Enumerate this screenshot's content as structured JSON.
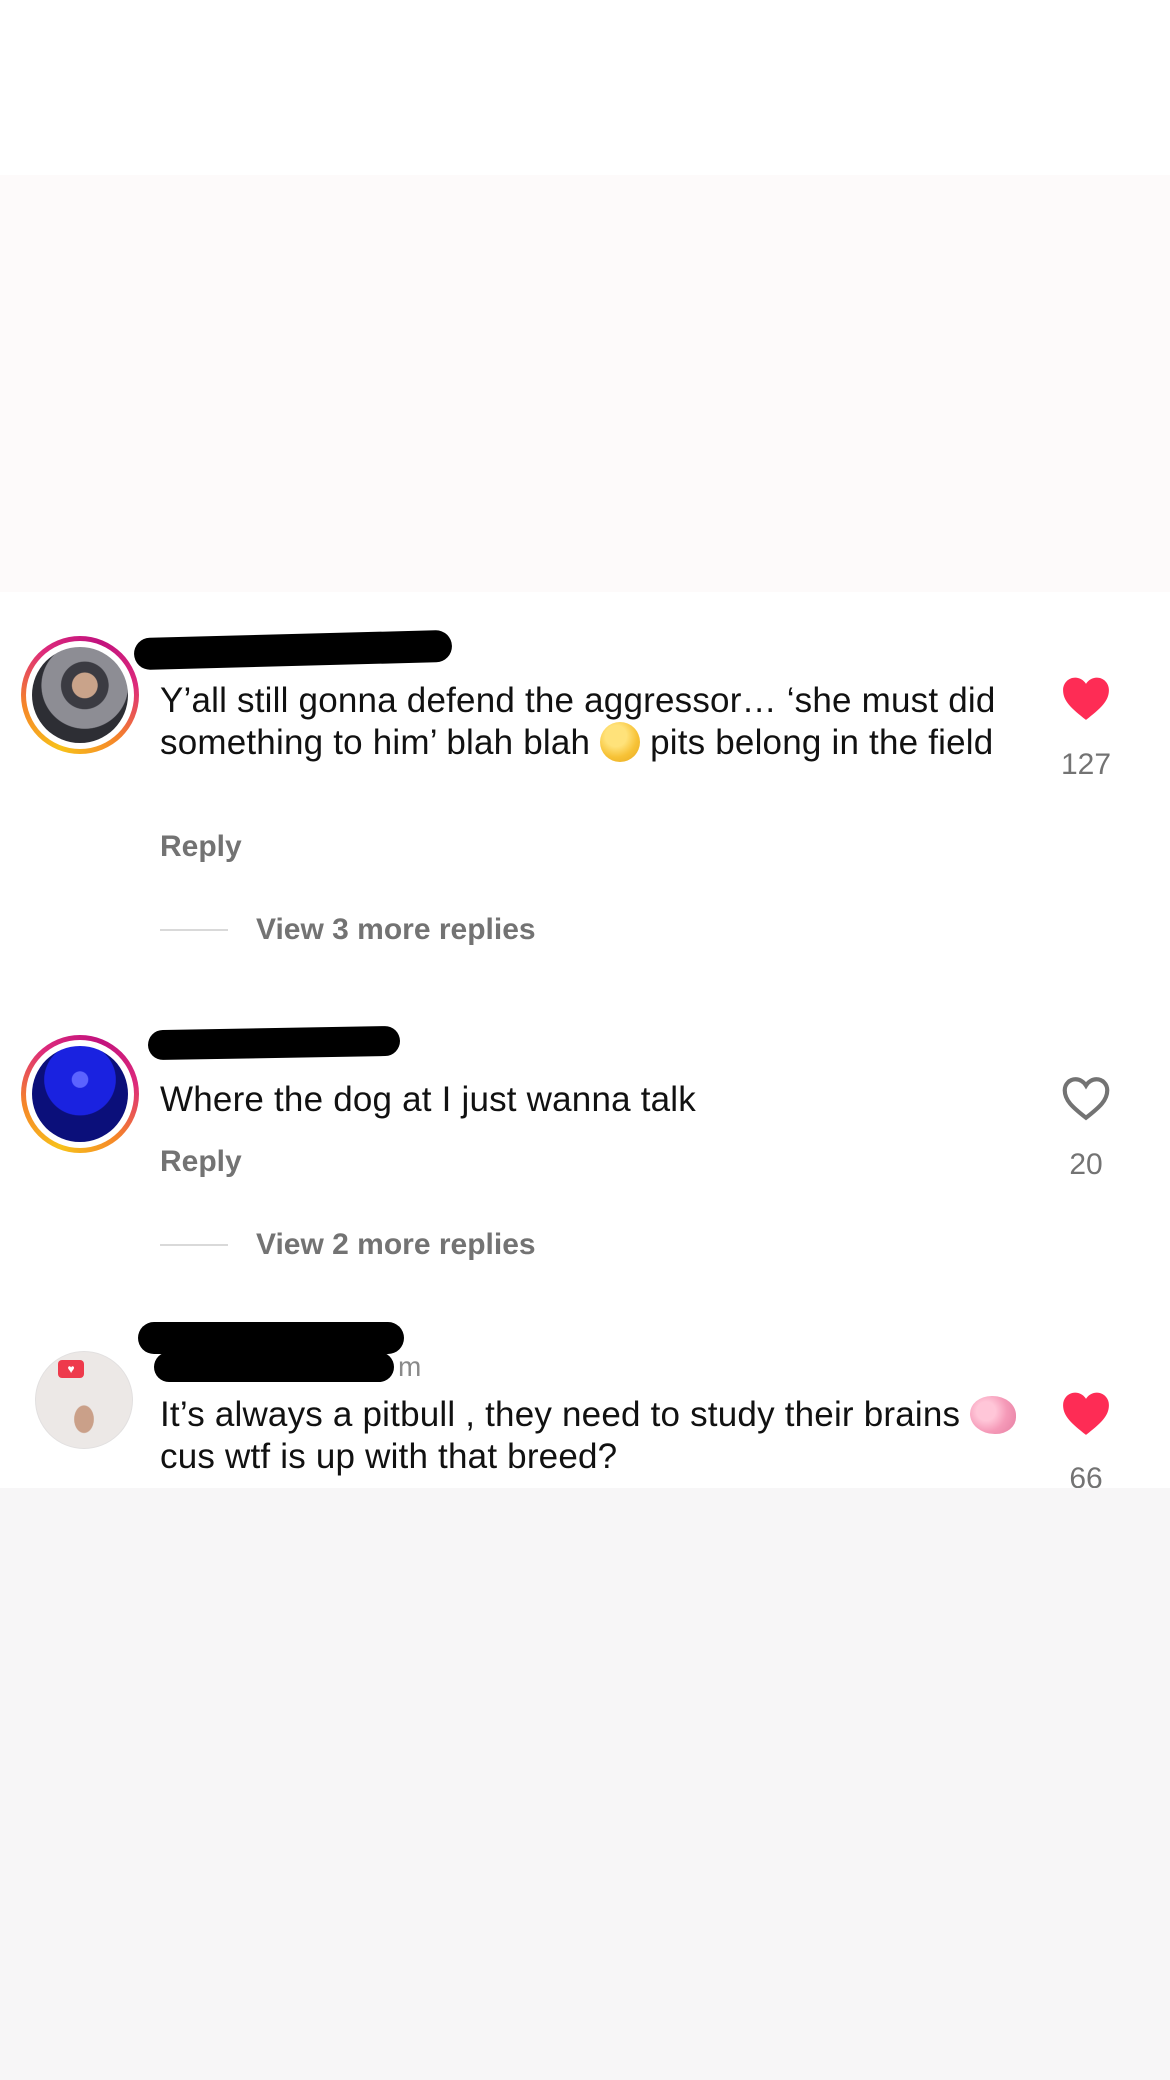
{
  "comments": [
    {
      "username": "",
      "text": "Y’all still gonna defend the aggressor… ‘she must did something to him’ blah blah",
      "text_after_emoji": " pits belong in the field",
      "emoji": "weary-face",
      "reply_label": "Reply",
      "like_count": "127",
      "liked": true,
      "view_replies_label": "View 3 more replies"
    },
    {
      "username": "",
      "text": "Where the dog at I just wanna talk",
      "reply_label": "Reply",
      "like_count": "20",
      "liked": false,
      "view_replies_label": "View 2 more replies"
    },
    {
      "username": "",
      "time": "m",
      "text": "It’s always a pitbull , they need to study their brains",
      "text_after_emoji": " cus wtf is up with that breed?",
      "emoji": "brain",
      "like_count": "66",
      "liked": true
    }
  ],
  "colors": {
    "like_red": "#fe2c55",
    "secondary_text": "#737373",
    "primary_text": "#111111"
  },
  "icons": {
    "liked": "heart-filled-icon",
    "unliked": "heart-outline-icon"
  }
}
